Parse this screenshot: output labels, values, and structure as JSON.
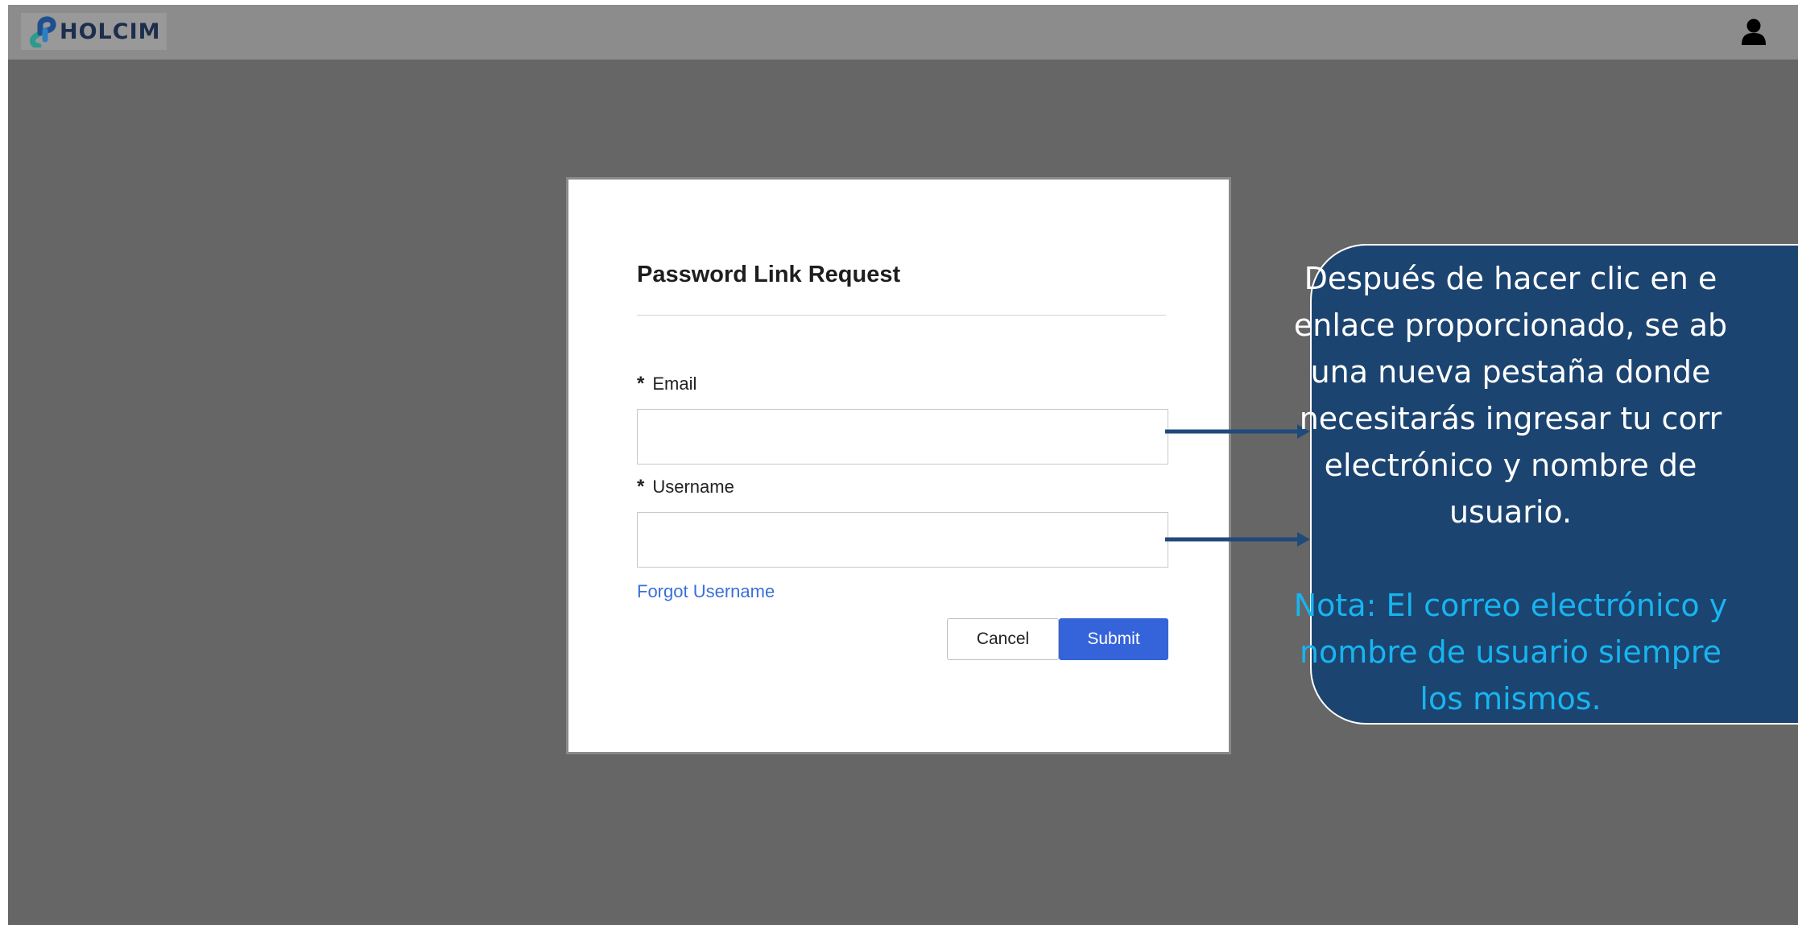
{
  "header": {
    "brand": "HOLCIM",
    "logo_icon": "holcim-logo-icon",
    "user_icon": "user-icon"
  },
  "dialog": {
    "title": "Password Link Request",
    "email": {
      "label": "Email",
      "required_marker": "*",
      "value": ""
    },
    "username": {
      "label": "Username",
      "required_marker": "*",
      "value": ""
    },
    "forgot_username_link": "Forgot Username",
    "cancel_label": "Cancel",
    "submit_label": "Submit"
  },
  "callout": {
    "main_lines": [
      "Después de hacer clic en e",
      "enlace proporcionado, se ab",
      "una nueva pestaña donde",
      "necesitarás ingresar tu corr",
      "electrónico y nombre de",
      "usuario."
    ],
    "note_lines": [
      "Nota: El correo electrónico y",
      "nombre de usuario siempre",
      "los mismos."
    ]
  },
  "colors": {
    "backdrop": "#666666",
    "topbar": "#8c8c8c",
    "submit": "#3563d9",
    "link": "#3b6fd8",
    "callout_bg": "#1c4470",
    "callout_note": "#18b4f0",
    "arrow": "#1f4a7a"
  }
}
